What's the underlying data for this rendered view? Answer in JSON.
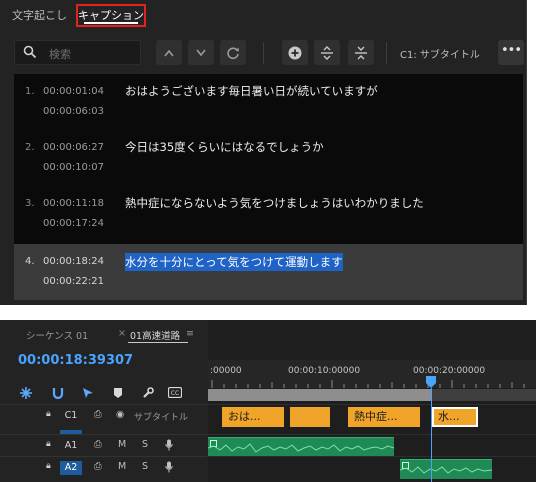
{
  "captions_panel": {
    "tabs": [
      {
        "label": "文字起こし",
        "active": false
      },
      {
        "label": "キャプション",
        "active": true
      }
    ],
    "search": {
      "placeholder": "検索"
    },
    "track_selector": "C1: サブタイトル",
    "more_label": "•••",
    "captions": [
      {
        "num": "1.",
        "in": "00:00:01:04",
        "out": "00:00:06:03",
        "text": "おはようございます毎日暑い日が続いていますが",
        "selected": false
      },
      {
        "num": "2.",
        "in": "00:00:06:27",
        "out": "00:00:10:07",
        "text": "今日は35度くらいにはなるでしょうか",
        "selected": false
      },
      {
        "num": "3.",
        "in": "00:00:11:18",
        "out": "00:00:17:24",
        "text": "熱中症にならないよう気をつけましょうはいわかりました",
        "selected": false
      },
      {
        "num": "4.",
        "in": "00:00:18:24",
        "out": "00:00:22:21",
        "text": "水分を十分にとって気をつけて運動します",
        "selected": true
      }
    ]
  },
  "timeline_panel": {
    "sequence_tabs": [
      "シーケンス 01",
      "01高速道路"
    ],
    "close_glyph": "×",
    "menu_glyph": "≡",
    "timecode": "00:00:18:39307",
    "ruler_labels": [
      ":00000",
      "00:00:10:00000",
      "00:00:20:00000"
    ],
    "tracks": [
      {
        "name": "C1",
        "label": "サブタイトル",
        "active": false
      },
      {
        "name": "A1",
        "active": false
      },
      {
        "name": "A2",
        "active": true
      }
    ],
    "track_toggles": {
      "mute": "M",
      "solo": "S"
    },
    "caption_clips": [
      "おは...",
      "",
      "熱中症...",
      "水..."
    ],
    "playhead_time": "00:00:18:39307",
    "colors": {
      "accent": "#4aa3ff",
      "caption_clip": "#f0a52a",
      "audio_clip": "#1f8a56",
      "selection": "#1f63c6",
      "tab_highlight": "#e0241b"
    }
  }
}
